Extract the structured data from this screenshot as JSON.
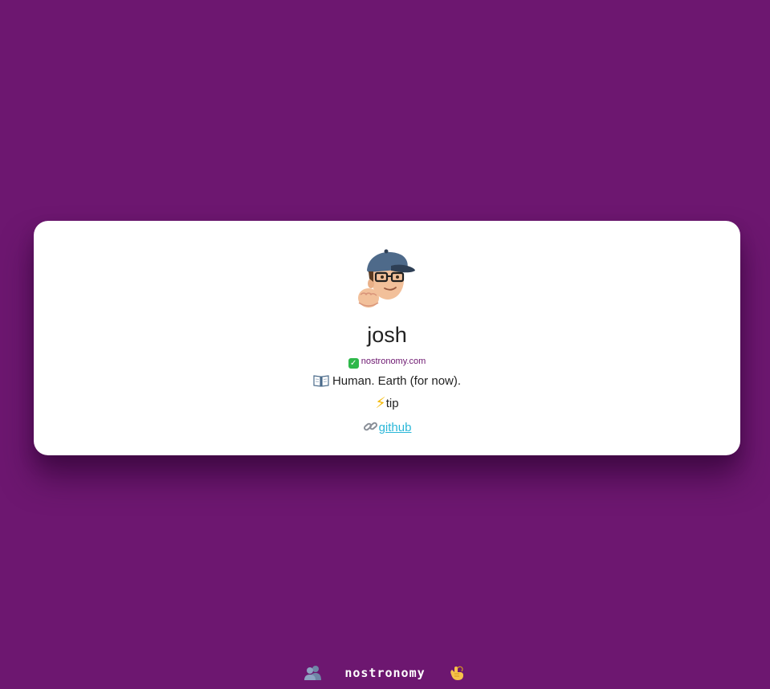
{
  "profile": {
    "name": "josh",
    "nip05": "nostronomy.com",
    "bio": "Human. Earth (for now).",
    "tip_label": "tip",
    "links": [
      {
        "label": "github"
      }
    ],
    "avatar_icon": "memoji-avatar"
  },
  "footer": {
    "brand": "nostronomy",
    "left_icon": "people-silhouette-icon",
    "right_icon": "call-me-hand-icon"
  },
  "colors": {
    "background": "#6d1770",
    "card": "#ffffff",
    "link": "#2ab7d8",
    "accent": "#6d1770"
  }
}
